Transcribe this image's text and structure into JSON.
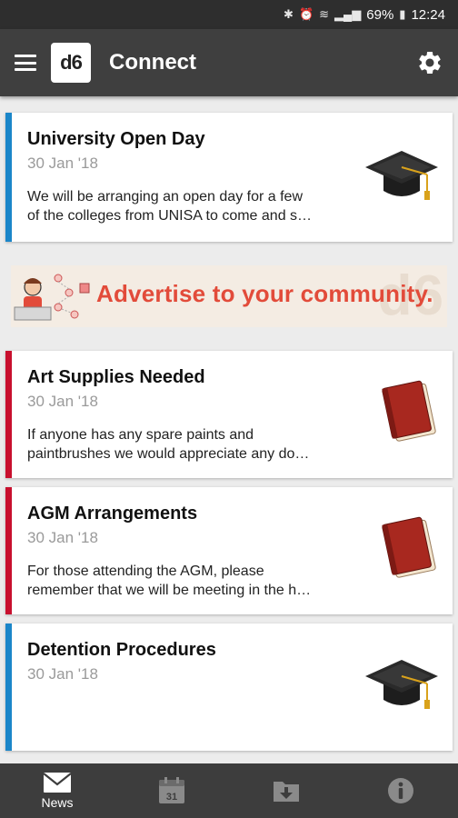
{
  "status_bar": {
    "battery": "69%",
    "time": "12:24"
  },
  "app_bar": {
    "logo_text": "d6",
    "title": "Connect"
  },
  "news": [
    {
      "title": "University Open Day",
      "date": "30 Jan '18",
      "snippet_line1": "We will be arranging an open day for a few",
      "snippet_line2": "of the colleges from UNISA to come and s…",
      "accent": "#1b86c9",
      "icon": "graduation-cap-icon"
    },
    {
      "title": "Art Supplies Needed",
      "date": "30 Jan '18",
      "snippet_line1": "If anyone has any spare paints and",
      "snippet_line2": "paintbrushes we would appreciate any do…",
      "accent": "#c8102e",
      "icon": "book-icon"
    },
    {
      "title": "AGM Arrangements",
      "date": "30 Jan '18",
      "snippet_line1": "For those attending the AGM, please",
      "snippet_line2": "remember that we will be meeting in the h…",
      "accent": "#c8102e",
      "icon": "book-icon"
    },
    {
      "title": "Detention Procedures",
      "date": "30 Jan '18",
      "accent": "#1b86c9",
      "icon": "graduation-cap-icon"
    }
  ],
  "ad": {
    "text": "Advertise to your community.",
    "watermark": "d6"
  },
  "bottom_nav": {
    "news_label": "News",
    "calendar_day": "31"
  }
}
